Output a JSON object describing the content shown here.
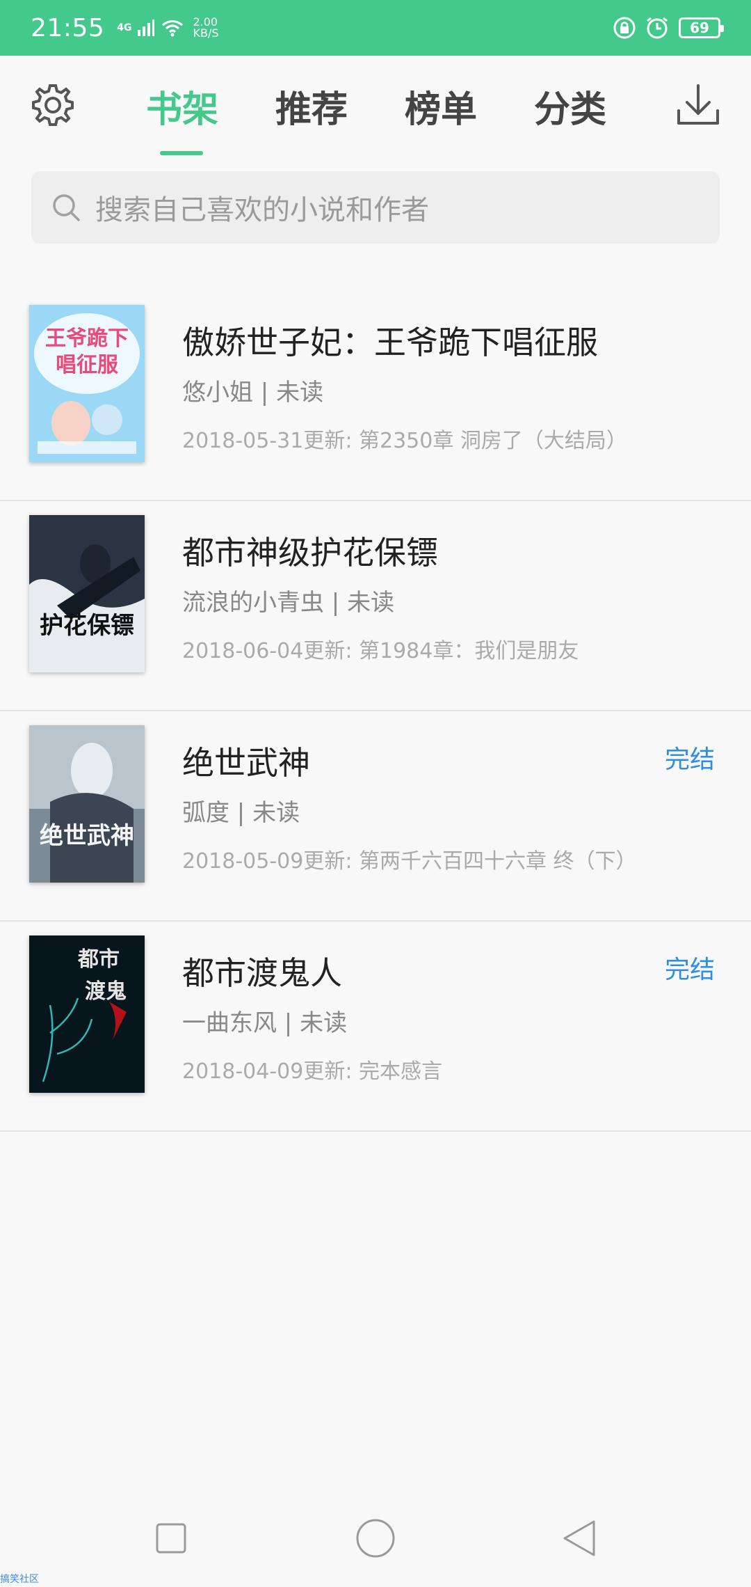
{
  "status_bar": {
    "time": "21:55",
    "network": "4G",
    "speed_value": "2.00",
    "speed_unit": "KB/S",
    "battery": "69"
  },
  "header": {
    "tabs": [
      {
        "label": "书架",
        "active": true
      },
      {
        "label": "推荐",
        "active": false
      },
      {
        "label": "榜单",
        "active": false
      },
      {
        "label": "分类",
        "active": false
      }
    ],
    "icons": [
      "gear-icon",
      "download-icon"
    ]
  },
  "search": {
    "placeholder": "搜索自己喜欢的小说和作者"
  },
  "books": [
    {
      "title": "傲娇世子妃：王爷跪下唱征服",
      "author_status": "悠小姐 | 未读",
      "update": "2018-05-31更新: 第2350章  洞房了（大结局）",
      "badge": "",
      "cover_text": "王爷跪下唱征服",
      "cover_colors": [
        "#8fd3f4",
        "#e8f7ff"
      ]
    },
    {
      "title": "都市神级护花保镖",
      "author_status": "流浪的小青虫 | 未读",
      "update": "2018-06-04更新: 第1984章：我们是朋友",
      "badge": "",
      "cover_text": "护花保镖",
      "cover_colors": [
        "#0f1d2b",
        "#5a6d86"
      ]
    },
    {
      "title": "绝世武神",
      "author_status": "弧度 | 未读",
      "update": "2018-05-09更新: 第两千六百四十六章 终（下）",
      "badge": "完结",
      "cover_text": "绝世武神",
      "cover_colors": [
        "#4b5a6a",
        "#c4ced6"
      ]
    },
    {
      "title": "都市渡鬼人",
      "author_status": "一曲东风 | 未读",
      "update": "2018-04-09更新: 完本感言",
      "badge": "完结",
      "cover_text": "都市渡鬼",
      "cover_colors": [
        "#05121a",
        "#1b3a4a"
      ]
    }
  ],
  "watermark": "搞笑社区",
  "colors": {
    "accent": "#43c98c",
    "badge": "#2e8ee0"
  }
}
